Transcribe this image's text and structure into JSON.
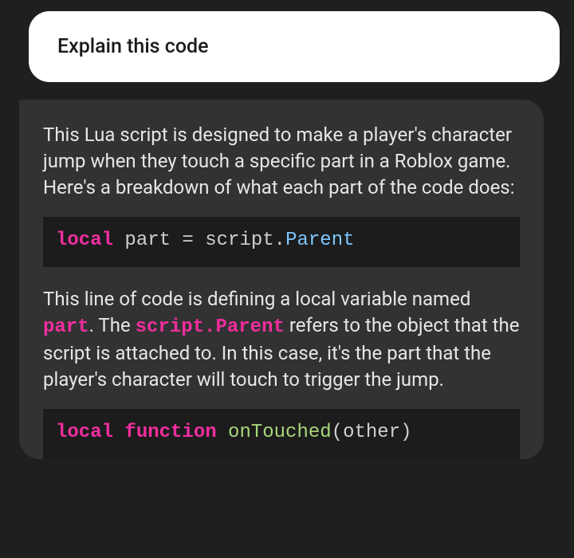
{
  "user": {
    "message": "Explain this code"
  },
  "assistant": {
    "intro": "This Lua script is designed to make a player's character jump when they touch a specific part in a Roblox game. Here's a breakdown of what each part of the code does:",
    "code1": {
      "kw_local": "local",
      "ident_part": "part",
      "eq": " = ",
      "ident_script": "script",
      "dot": ".",
      "prop_parent": "Parent"
    },
    "p2_1": "This line of code is defining a local variable named ",
    "p2_inline_part": "part",
    "p2_2": ". The ",
    "p2_inline_sp": "script.Parent",
    "p2_3": " refers to the object that the script is attached to. In this case, it's the part that the player's character will touch to trigger the jump.",
    "code2": {
      "kw_local": "local",
      "kw_function": "function",
      "fn_name": "onTouched",
      "open": "(",
      "arg": "other",
      "close": ")"
    }
  }
}
